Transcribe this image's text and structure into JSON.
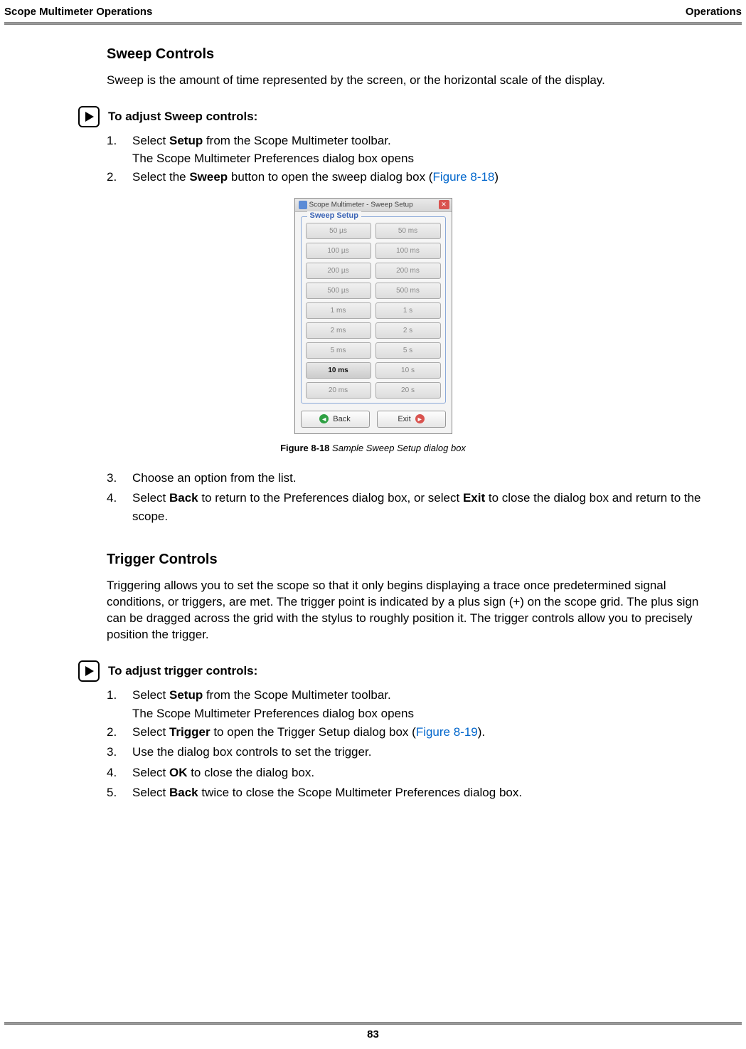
{
  "header": {
    "left": "Scope Multimeter Operations",
    "right": "Operations"
  },
  "section1": {
    "heading": "Sweep Controls",
    "intro": "Sweep is the amount of time represented by the screen, or the horizontal scale of the display.",
    "proc_title": "To adjust Sweep controls:",
    "step1_pre": "Select ",
    "step1_bold": "Setup",
    "step1_post": " from the Scope Multimeter toolbar.",
    "step1_sub": "The Scope Multimeter Preferences dialog box opens",
    "step2_pre": "Select the ",
    "step2_bold": "Sweep",
    "step2_post": " button to open the sweep dialog box (",
    "step2_ref": "Figure 8-18",
    "step2_end": ")",
    "step3": "Choose an option from the list.",
    "step4_pre": "Select ",
    "step4_b1": "Back",
    "step4_mid": " to return to the Preferences dialog box, or select ",
    "step4_b2": "Exit",
    "step4_post": " to close the dialog box and return to the scope."
  },
  "dialog": {
    "title": "Scope Multimeter - Sweep Setup",
    "legend": "Sweep Setup",
    "options_left": [
      "50 µs",
      "100 µs",
      "200 µs",
      "500 µs",
      "1 ms",
      "2 ms",
      "5 ms",
      "10 ms",
      "20 ms"
    ],
    "options_right": [
      "50 ms",
      "100 ms",
      "200 ms",
      "500 ms",
      "1 s",
      "2 s",
      "5 s",
      "10 s",
      "20 s"
    ],
    "selected": "10 ms",
    "back": "Back",
    "exit": "Exit"
  },
  "figure1": {
    "label": "Figure 8-18 ",
    "desc": "Sample Sweep Setup dialog box"
  },
  "section2": {
    "heading": "Trigger Controls",
    "intro": "Triggering allows you to set the scope so that it only begins displaying a trace once predetermined signal conditions, or triggers, are met. The trigger point is indicated by a plus sign (+) on the scope grid. The plus sign can be dragged across the grid with the stylus to roughly position it. The trigger controls allow you to precisely position the trigger.",
    "proc_title": "To adjust trigger controls:",
    "step1_pre": "Select ",
    "step1_bold": "Setup",
    "step1_post": " from the Scope Multimeter toolbar.",
    "step1_sub": "The Scope Multimeter Preferences dialog box opens",
    "step2_pre": "Select ",
    "step2_bold": "Trigger",
    "step2_post": " to open the Trigger Setup dialog box (",
    "step2_ref": "Figure 8-19",
    "step2_end": ").",
    "step3": "Use the dialog box controls to set the trigger.",
    "step4_pre": "Select ",
    "step4_bold": "OK",
    "step4_post": " to close the dialog box.",
    "step5_pre": "Select ",
    "step5_bold": "Back",
    "step5_post": " twice to close the Scope Multimeter Preferences dialog box."
  },
  "page_number": "83"
}
